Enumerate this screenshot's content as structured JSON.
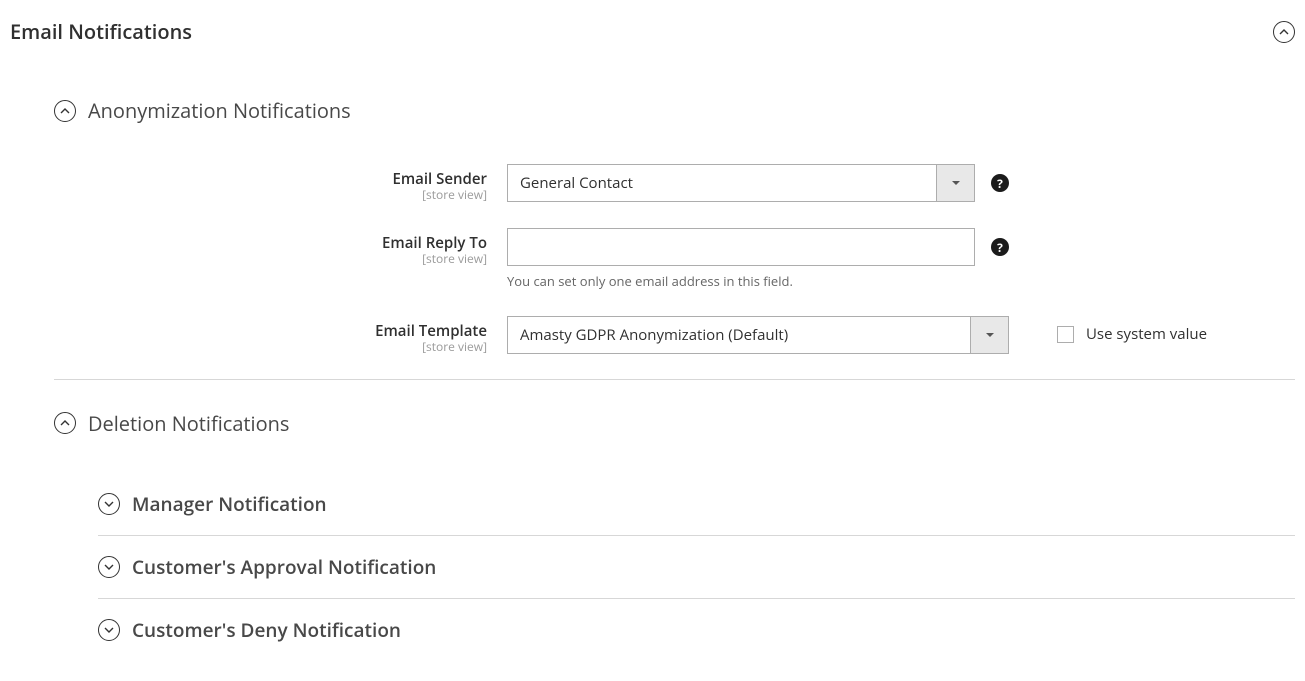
{
  "main": {
    "title": "Email Notifications"
  },
  "anon": {
    "title": "Anonymization Notifications",
    "sender": {
      "label": "Email Sender",
      "scope": "[store view]",
      "value": "General Contact"
    },
    "reply": {
      "label": "Email Reply To",
      "scope": "[store view]",
      "value": "",
      "note": "You can set only one email address in this field."
    },
    "template": {
      "label": "Email Template",
      "scope": "[store view]",
      "value": "Amasty GDPR Anonymization (Default)",
      "system_label": "Use system value",
      "system_checked": false
    }
  },
  "deletion": {
    "title": "Deletion Notifications",
    "items": [
      {
        "title": "Manager Notification"
      },
      {
        "title": "Customer's Approval Notification"
      },
      {
        "title": "Customer's Deny Notification"
      }
    ]
  }
}
